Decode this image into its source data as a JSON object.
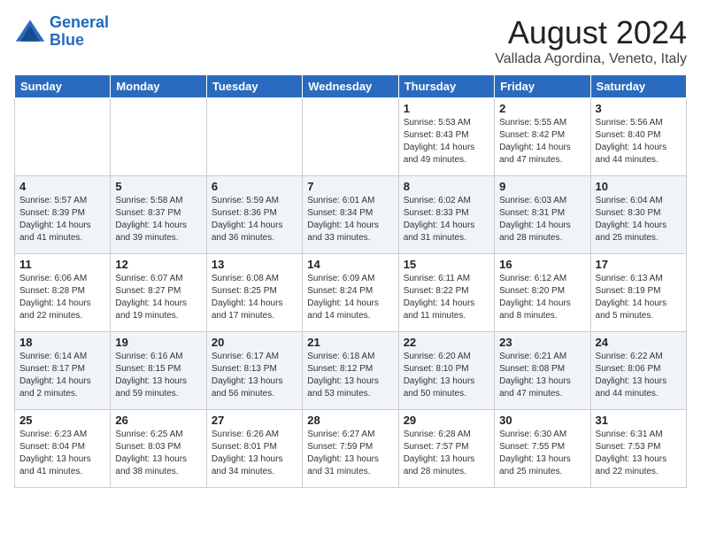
{
  "header": {
    "logo_line1": "General",
    "logo_line2": "Blue",
    "month_title": "August 2024",
    "location": "Vallada Agordina, Veneto, Italy"
  },
  "days_of_week": [
    "Sunday",
    "Monday",
    "Tuesday",
    "Wednesday",
    "Thursday",
    "Friday",
    "Saturday"
  ],
  "weeks": [
    [
      {
        "day": "",
        "info": ""
      },
      {
        "day": "",
        "info": ""
      },
      {
        "day": "",
        "info": ""
      },
      {
        "day": "",
        "info": ""
      },
      {
        "day": "1",
        "info": "Sunrise: 5:53 AM\nSunset: 8:43 PM\nDaylight: 14 hours\nand 49 minutes."
      },
      {
        "day": "2",
        "info": "Sunrise: 5:55 AM\nSunset: 8:42 PM\nDaylight: 14 hours\nand 47 minutes."
      },
      {
        "day": "3",
        "info": "Sunrise: 5:56 AM\nSunset: 8:40 PM\nDaylight: 14 hours\nand 44 minutes."
      }
    ],
    [
      {
        "day": "4",
        "info": "Sunrise: 5:57 AM\nSunset: 8:39 PM\nDaylight: 14 hours\nand 41 minutes."
      },
      {
        "day": "5",
        "info": "Sunrise: 5:58 AM\nSunset: 8:37 PM\nDaylight: 14 hours\nand 39 minutes."
      },
      {
        "day": "6",
        "info": "Sunrise: 5:59 AM\nSunset: 8:36 PM\nDaylight: 14 hours\nand 36 minutes."
      },
      {
        "day": "7",
        "info": "Sunrise: 6:01 AM\nSunset: 8:34 PM\nDaylight: 14 hours\nand 33 minutes."
      },
      {
        "day": "8",
        "info": "Sunrise: 6:02 AM\nSunset: 8:33 PM\nDaylight: 14 hours\nand 31 minutes."
      },
      {
        "day": "9",
        "info": "Sunrise: 6:03 AM\nSunset: 8:31 PM\nDaylight: 14 hours\nand 28 minutes."
      },
      {
        "day": "10",
        "info": "Sunrise: 6:04 AM\nSunset: 8:30 PM\nDaylight: 14 hours\nand 25 minutes."
      }
    ],
    [
      {
        "day": "11",
        "info": "Sunrise: 6:06 AM\nSunset: 8:28 PM\nDaylight: 14 hours\nand 22 minutes."
      },
      {
        "day": "12",
        "info": "Sunrise: 6:07 AM\nSunset: 8:27 PM\nDaylight: 14 hours\nand 19 minutes."
      },
      {
        "day": "13",
        "info": "Sunrise: 6:08 AM\nSunset: 8:25 PM\nDaylight: 14 hours\nand 17 minutes."
      },
      {
        "day": "14",
        "info": "Sunrise: 6:09 AM\nSunset: 8:24 PM\nDaylight: 14 hours\nand 14 minutes."
      },
      {
        "day": "15",
        "info": "Sunrise: 6:11 AM\nSunset: 8:22 PM\nDaylight: 14 hours\nand 11 minutes."
      },
      {
        "day": "16",
        "info": "Sunrise: 6:12 AM\nSunset: 8:20 PM\nDaylight: 14 hours\nand 8 minutes."
      },
      {
        "day": "17",
        "info": "Sunrise: 6:13 AM\nSunset: 8:19 PM\nDaylight: 14 hours\nand 5 minutes."
      }
    ],
    [
      {
        "day": "18",
        "info": "Sunrise: 6:14 AM\nSunset: 8:17 PM\nDaylight: 14 hours\nand 2 minutes."
      },
      {
        "day": "19",
        "info": "Sunrise: 6:16 AM\nSunset: 8:15 PM\nDaylight: 13 hours\nand 59 minutes."
      },
      {
        "day": "20",
        "info": "Sunrise: 6:17 AM\nSunset: 8:13 PM\nDaylight: 13 hours\nand 56 minutes."
      },
      {
        "day": "21",
        "info": "Sunrise: 6:18 AM\nSunset: 8:12 PM\nDaylight: 13 hours\nand 53 minutes."
      },
      {
        "day": "22",
        "info": "Sunrise: 6:20 AM\nSunset: 8:10 PM\nDaylight: 13 hours\nand 50 minutes."
      },
      {
        "day": "23",
        "info": "Sunrise: 6:21 AM\nSunset: 8:08 PM\nDaylight: 13 hours\nand 47 minutes."
      },
      {
        "day": "24",
        "info": "Sunrise: 6:22 AM\nSunset: 8:06 PM\nDaylight: 13 hours\nand 44 minutes."
      }
    ],
    [
      {
        "day": "25",
        "info": "Sunrise: 6:23 AM\nSunset: 8:04 PM\nDaylight: 13 hours\nand 41 minutes."
      },
      {
        "day": "26",
        "info": "Sunrise: 6:25 AM\nSunset: 8:03 PM\nDaylight: 13 hours\nand 38 minutes."
      },
      {
        "day": "27",
        "info": "Sunrise: 6:26 AM\nSunset: 8:01 PM\nDaylight: 13 hours\nand 34 minutes."
      },
      {
        "day": "28",
        "info": "Sunrise: 6:27 AM\nSunset: 7:59 PM\nDaylight: 13 hours\nand 31 minutes."
      },
      {
        "day": "29",
        "info": "Sunrise: 6:28 AM\nSunset: 7:57 PM\nDaylight: 13 hours\nand 28 minutes."
      },
      {
        "day": "30",
        "info": "Sunrise: 6:30 AM\nSunset: 7:55 PM\nDaylight: 13 hours\nand 25 minutes."
      },
      {
        "day": "31",
        "info": "Sunrise: 6:31 AM\nSunset: 7:53 PM\nDaylight: 13 hours\nand 22 minutes."
      }
    ]
  ]
}
